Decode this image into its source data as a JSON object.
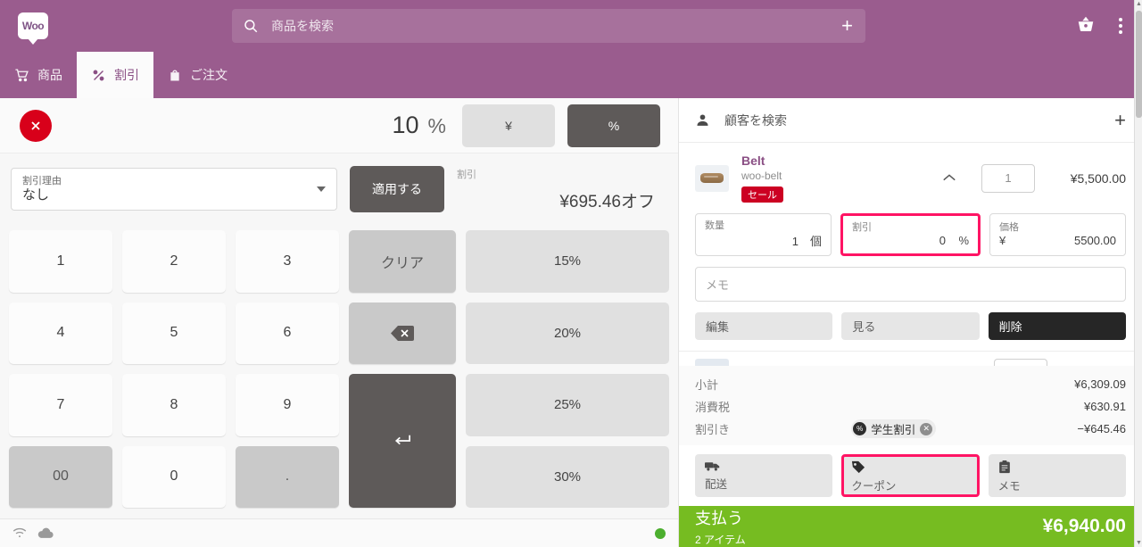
{
  "topbar": {
    "logo_text": "Woo",
    "search_placeholder": "商品を検索",
    "add_label": "+",
    "cart_icon": "shopping-basket-icon",
    "menu_icon": "kebab-menu-icon"
  },
  "tabs": [
    {
      "label": "商品",
      "icon": "cart-icon",
      "active": false
    },
    {
      "label": "割引",
      "icon": "percent-icon",
      "active": true
    },
    {
      "label": "ご注文",
      "icon": "bag-icon",
      "active": false
    }
  ],
  "discount_panel": {
    "close_icon": "close-circle-icon",
    "value": "10",
    "unit": "%",
    "type_yen": "¥",
    "type_percent": "%",
    "reason_label": "割引理由",
    "reason_value": "なし",
    "apply_label": "適用する",
    "off_caption": "割引",
    "off_amount": "¥695.46オフ",
    "keypad": [
      {
        "label": "1",
        "style": "num"
      },
      {
        "label": "2",
        "style": "num"
      },
      {
        "label": "3",
        "style": "num"
      },
      {
        "label": "クリア",
        "style": "grey"
      },
      {
        "label": "15%",
        "style": "lgrey"
      },
      {
        "label": "4",
        "style": "num"
      },
      {
        "label": "5",
        "style": "num"
      },
      {
        "label": "6",
        "style": "num"
      },
      {
        "label": "⌫",
        "style": "grey"
      },
      {
        "label": "20%",
        "style": "lgrey"
      },
      {
        "label": "7",
        "style": "num"
      },
      {
        "label": "8",
        "style": "num"
      },
      {
        "label": "9",
        "style": "num"
      },
      {
        "label": "↵",
        "style": "dark"
      },
      {
        "label": "25%",
        "style": "lgrey"
      },
      {
        "label": "00",
        "style": "grey"
      },
      {
        "label": "0",
        "style": "num"
      },
      {
        "label": ".",
        "style": "grey"
      },
      {
        "label": "30%",
        "style": "lgrey"
      }
    ]
  },
  "statusbar": {
    "wifi_icon": "wifi-icon",
    "cloud_icon": "cloud-icon",
    "status_dot_color": "#4caf2f"
  },
  "cart": {
    "customer_placeholder": "顧客を検索",
    "customer_icon": "person-icon",
    "add_customer_label": "+",
    "product": {
      "name": "Belt",
      "sku": "woo-belt",
      "badge": "セール",
      "quantity": "1",
      "price": "¥5,500.00",
      "collapse_icon": "chevron-up-icon"
    },
    "fields": {
      "qty_label": "数量",
      "qty_value": "1",
      "qty_unit": "個",
      "discount_label": "割引",
      "discount_value": "0",
      "discount_unit": "%",
      "price_label": "価格",
      "price_currency": "¥",
      "price_value": "5500.00"
    },
    "memo_placeholder": "メモ",
    "actions": [
      {
        "label": "編集",
        "style": "light"
      },
      {
        "label": "見る",
        "style": "light"
      },
      {
        "label": "削除",
        "style": "dark"
      }
    ],
    "totals": [
      {
        "label": "小計",
        "amount": "¥6,309.09"
      },
      {
        "label": "消費税",
        "amount": "¥630.91"
      },
      {
        "label": "割引き",
        "amount": "−¥645.46",
        "chip": "学生割引",
        "chip_icon": "percent-circle-icon",
        "chip_remove_icon": "remove-circle-icon"
      }
    ],
    "bottom_actions": [
      {
        "label": "配送",
        "icon": "truck-icon",
        "highlighted": false
      },
      {
        "label": "クーポン",
        "icon": "tag-icon",
        "highlighted": true
      },
      {
        "label": "メモ",
        "icon": "clipboard-icon",
        "highlighted": false
      }
    ],
    "pay": {
      "label": "支払う",
      "items": "2 アイテム",
      "total": "¥6,940.00",
      "color": "#76bc21"
    }
  }
}
